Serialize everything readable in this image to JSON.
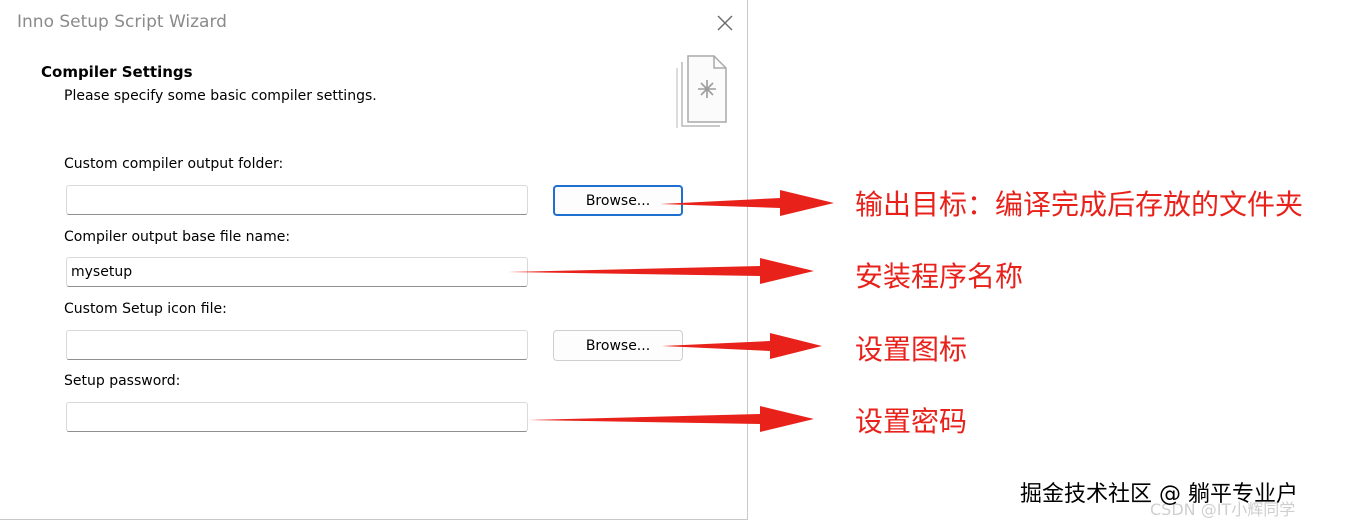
{
  "window": {
    "title": "Inno Setup Script Wizard",
    "close_icon": "close-icon"
  },
  "page": {
    "heading": "Compiler Settings",
    "subheading": "Please specify some basic compiler settings.",
    "wizard_icon": "document-stack-icon"
  },
  "fields": {
    "output_folder": {
      "label": "Custom compiler output folder:",
      "value": "",
      "browse": "Browse..."
    },
    "base_file_name": {
      "label": "Compiler output base file name:",
      "value": "mysetup"
    },
    "icon_file": {
      "label": "Custom Setup icon file:",
      "value": "",
      "browse": "Browse..."
    },
    "password": {
      "label": "Setup password:",
      "value": ""
    }
  },
  "annotations": {
    "output_folder": "输出目标：编译完成后存放的文件夹",
    "base_file_name": "安装程序名称",
    "icon_file": "设置图标",
    "password": "设置密码"
  },
  "colors": {
    "annotation": "#e8221b",
    "focus_border": "#1f6fd1"
  },
  "watermark": {
    "main": "掘金技术社区 @ 躺平专业户",
    "sub": "CSDN @IT小辉同学"
  }
}
